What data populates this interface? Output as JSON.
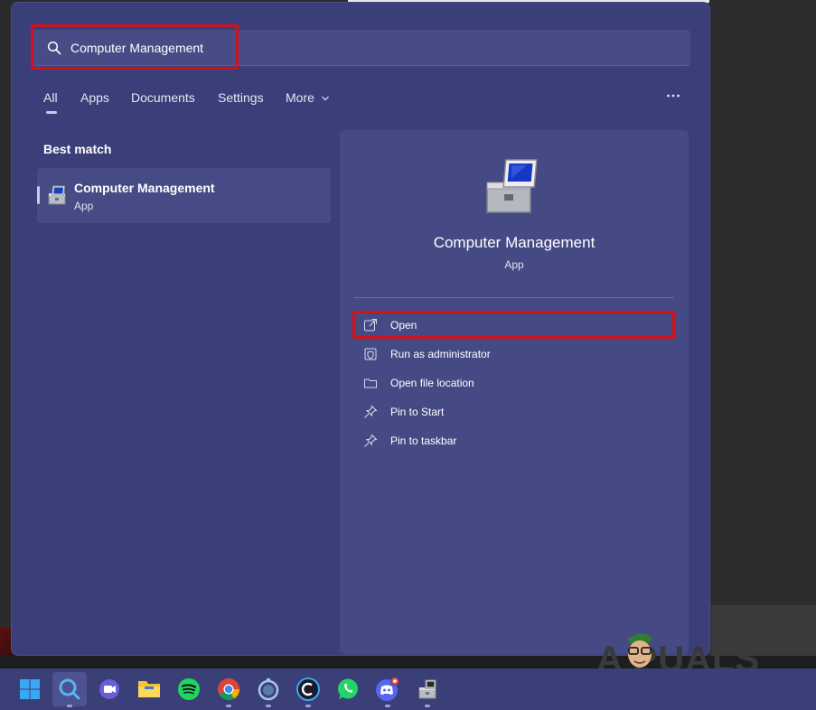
{
  "search": {
    "query": "Computer Management"
  },
  "tabs": [
    {
      "label": "All"
    },
    {
      "label": "Apps"
    },
    {
      "label": "Documents"
    },
    {
      "label": "Settings"
    },
    {
      "label": "More"
    }
  ],
  "best_match": {
    "heading": "Best match",
    "result": {
      "name": "Computer Management",
      "type": "App"
    }
  },
  "detail": {
    "name": "Computer Management",
    "type": "App",
    "actions": [
      {
        "label": "Open",
        "icon": "open-external-icon"
      },
      {
        "label": "Run as administrator",
        "icon": "shield-icon"
      },
      {
        "label": "Open file location",
        "icon": "folder-icon"
      },
      {
        "label": "Pin to Start",
        "icon": "pin-icon"
      },
      {
        "label": "Pin to taskbar",
        "icon": "pin-icon"
      }
    ]
  },
  "watermark": {
    "text": "A PUALS"
  },
  "taskbar": {
    "items": [
      {
        "icon": "windows-start-icon"
      },
      {
        "icon": "search-icon"
      },
      {
        "icon": "teams-chat-icon"
      },
      {
        "icon": "file-explorer-icon"
      },
      {
        "icon": "spotify-icon"
      },
      {
        "icon": "chrome-icon"
      },
      {
        "icon": "app-icon"
      },
      {
        "icon": "ccleaner-icon"
      },
      {
        "icon": "whatsapp-icon"
      },
      {
        "icon": "discord-icon"
      },
      {
        "icon": "computer-management-icon"
      }
    ]
  },
  "colors": {
    "panel": "#3a3f79",
    "highlight_red": "#d0121b",
    "taskbar": "#3b3f78"
  }
}
